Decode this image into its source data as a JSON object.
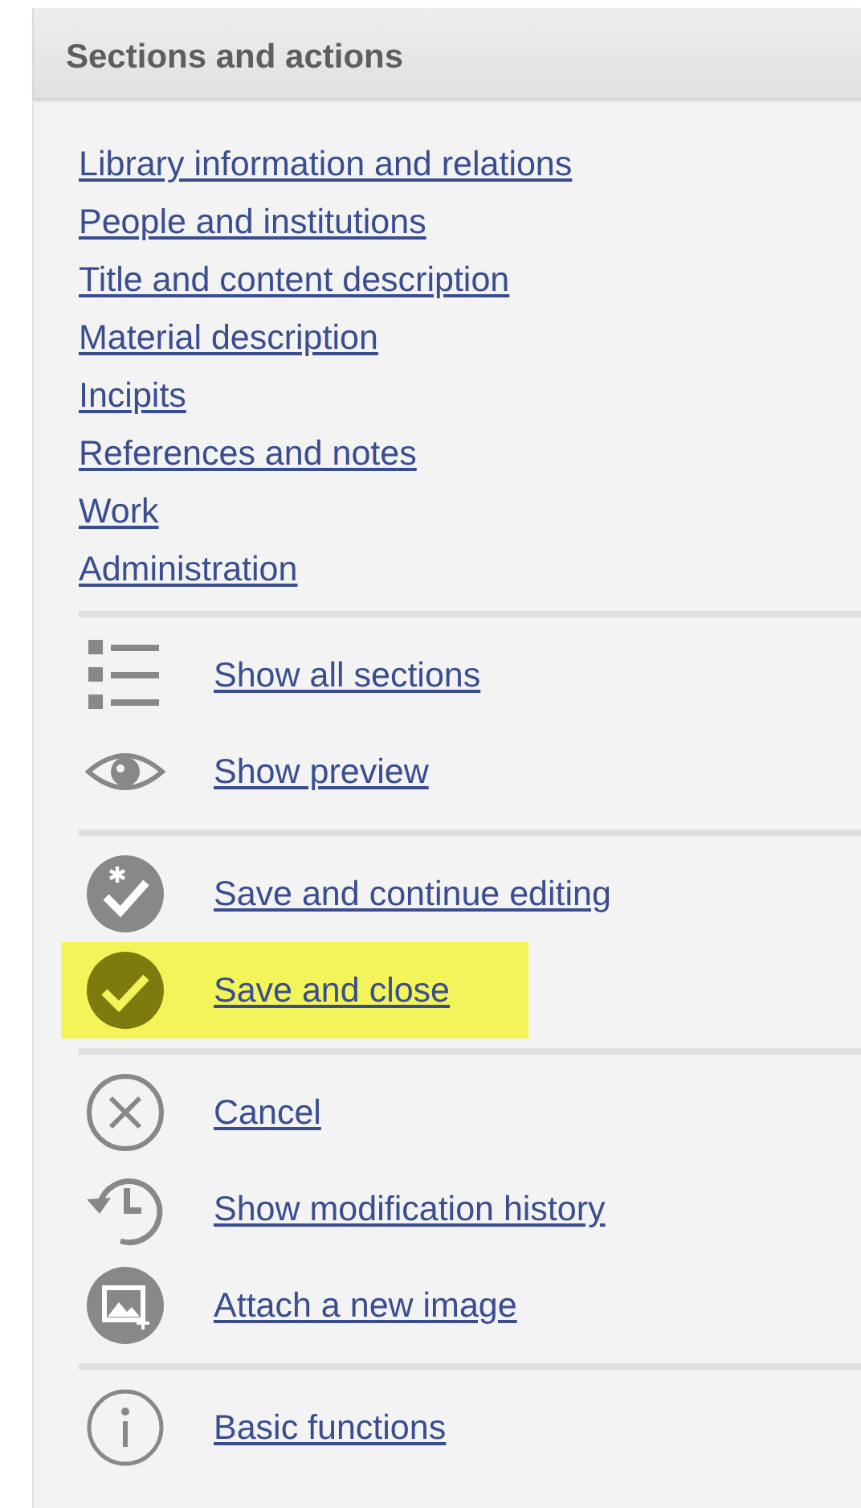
{
  "panel": {
    "title": "Sections and actions"
  },
  "sections": [
    {
      "label": "Library information and relations"
    },
    {
      "label": "People and institutions"
    },
    {
      "label": "Title and content description"
    },
    {
      "label": "Material description"
    },
    {
      "label": "Incipits"
    },
    {
      "label": "References and notes"
    },
    {
      "label": "Work"
    },
    {
      "label": "Administration"
    }
  ],
  "action_groups": [
    [
      {
        "kind": "list",
        "label": "Show all sections",
        "highlighted": false
      },
      {
        "kind": "eye",
        "label": "Show preview",
        "highlighted": false
      }
    ],
    [
      {
        "kind": "check-star",
        "label": "Save and continue editing",
        "highlighted": false
      },
      {
        "kind": "check",
        "label": "Save and close",
        "highlighted": true
      }
    ],
    [
      {
        "kind": "cancel",
        "label": "Cancel",
        "highlighted": false
      },
      {
        "kind": "history",
        "label": "Show modification history",
        "highlighted": false
      },
      {
        "kind": "image",
        "label": "Attach a new image",
        "highlighted": false
      }
    ],
    [
      {
        "kind": "info",
        "label": "Basic functions",
        "highlighted": false
      }
    ]
  ]
}
